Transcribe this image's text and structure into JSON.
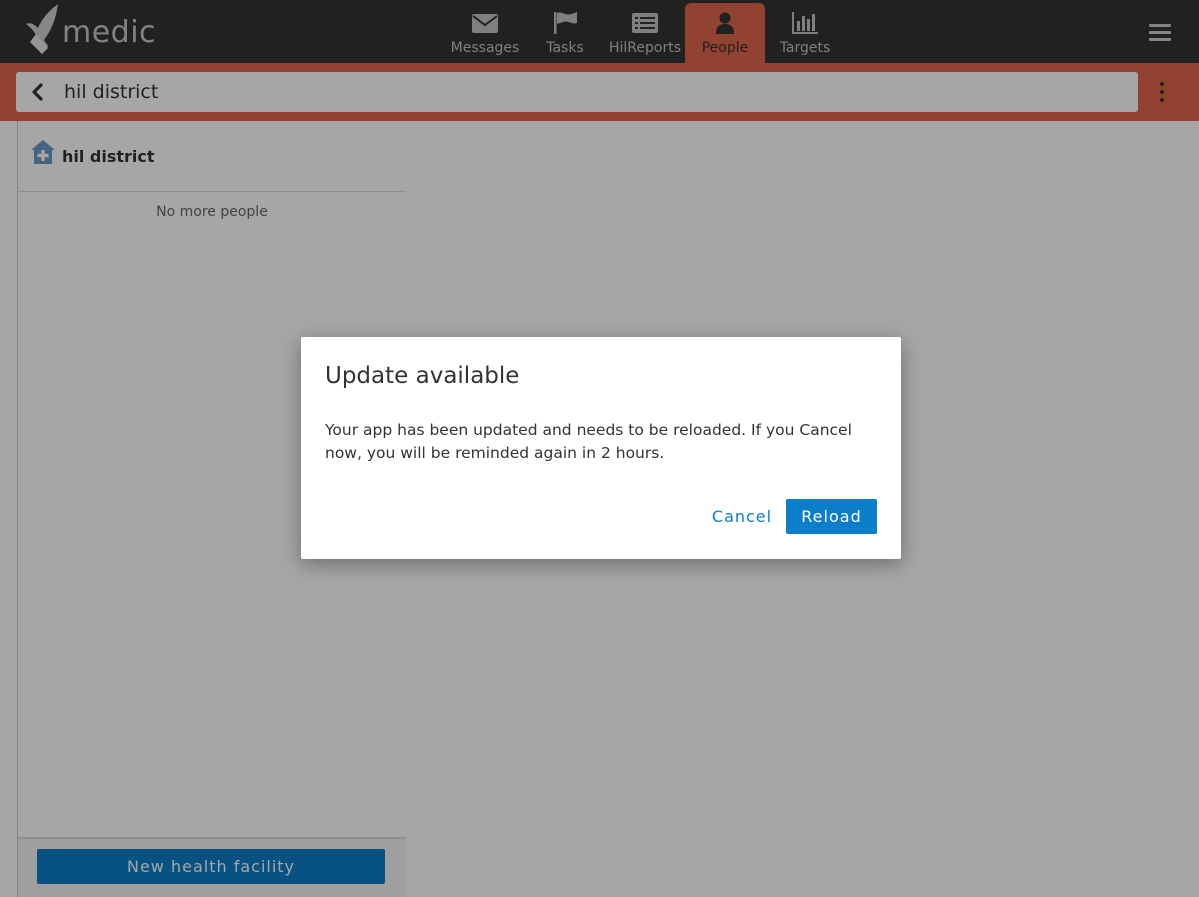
{
  "app": {
    "logo_text": "medic"
  },
  "nav": {
    "tabs": [
      {
        "label": "Messages",
        "icon": "envelope-icon",
        "active": false
      },
      {
        "label": "Tasks",
        "icon": "flag-icon",
        "active": false
      },
      {
        "label": "HilReports",
        "icon": "list-icon",
        "active": false
      },
      {
        "label": "People",
        "icon": "person-icon",
        "active": true
      },
      {
        "label": "Targets",
        "icon": "bar-chart-icon",
        "active": false
      }
    ]
  },
  "header": {
    "title": "hil district"
  },
  "sidebar": {
    "place_name": "hil district",
    "empty_text": "No more people",
    "new_button_label": "New health facility"
  },
  "dialog": {
    "title": "Update available",
    "body": "Your app has been updated and needs to be reloaded. If you Cancel now, you will be reminded again in 2 hours.",
    "cancel_label": "Cancel",
    "reload_label": "Reload"
  },
  "colors": {
    "accent_orange": "#e0664b",
    "primary_blue": "#0b7ec9",
    "nav_dark": "#333333"
  }
}
